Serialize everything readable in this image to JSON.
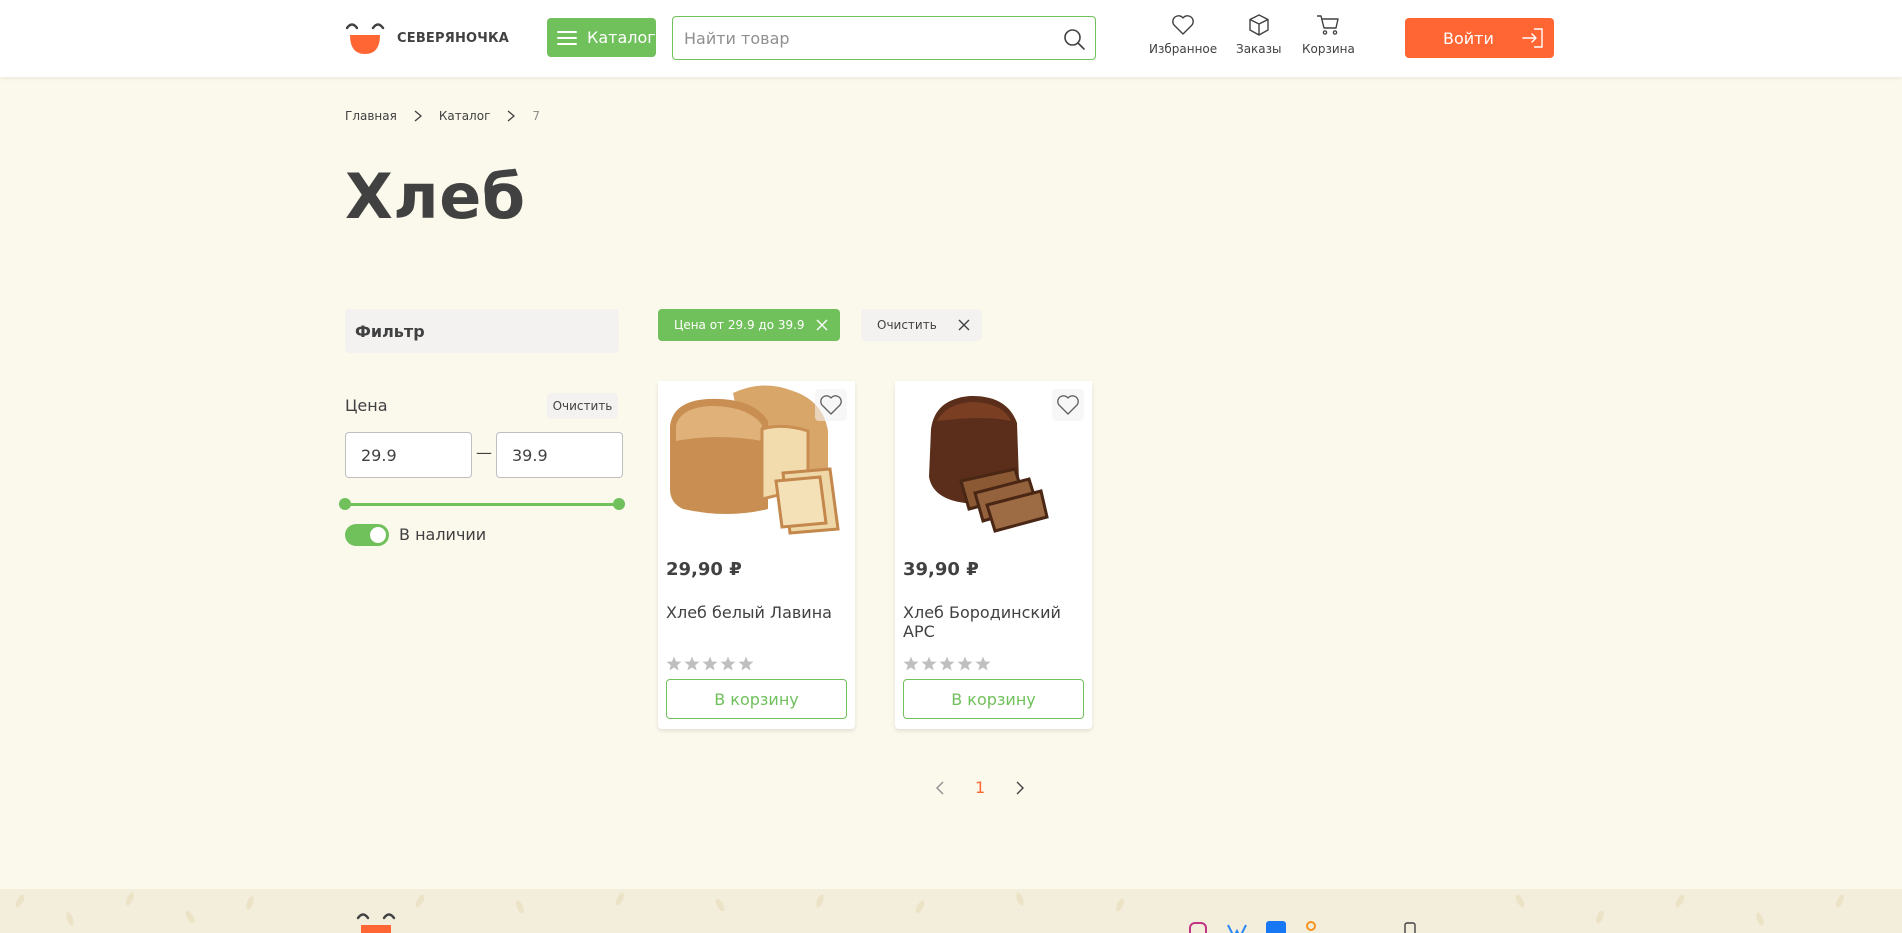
{
  "header": {
    "logo_text": "СЕВЕРЯНОЧКА",
    "catalog_label": "Каталог",
    "search_placeholder": "Найти товар",
    "nav": {
      "favorites": "Избранное",
      "orders": "Заказы",
      "cart": "Корзина"
    },
    "login_label": "Войти"
  },
  "breadcrumbs": [
    "Главная",
    "Каталог",
    "7"
  ],
  "page_title": "Хлеб",
  "filter": {
    "title": "Фильтр",
    "price_label": "Цена",
    "clear_label": "Очистить",
    "price_from": "29.9",
    "price_to": "39.9",
    "range_fill": 1.0,
    "in_stock_label": "В наличии",
    "in_stock_on": true
  },
  "chips": {
    "price_chip": "Цена от 29.9 до 39.9",
    "clear_chip": "Очистить"
  },
  "products": [
    {
      "price": "29,90 ₽",
      "name": "Хлеб белый Лавина",
      "button": "В корзину",
      "rating": 0
    },
    {
      "price": "39,90 ₽",
      "name": "Хлеб Бородинский АРС",
      "button": "В корзину",
      "rating": 0
    }
  ],
  "pagination": {
    "current": "1"
  },
  "colors": {
    "accent_green": "#70c05b",
    "accent_orange": "#ff6633",
    "background": "#fbf8ec",
    "text": "#414141"
  }
}
